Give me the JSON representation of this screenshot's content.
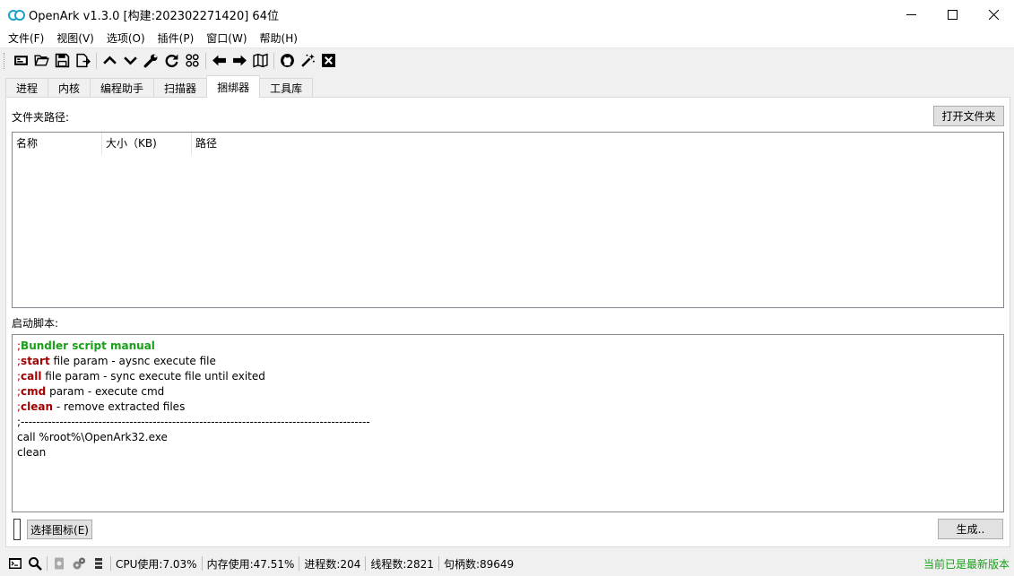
{
  "window": {
    "title": "OpenArk v1.3.0 [构建:202302271420]  64位",
    "accent": "#1aa3c8"
  },
  "menu": [
    "文件(F)",
    "视图(V)",
    "选项(O)",
    "插件(P)",
    "窗口(W)",
    "帮助(H)"
  ],
  "toolbar": {
    "icons": [
      "console-icon",
      "open-folder-icon",
      "save-icon",
      "export-icon",
      "chevron-up-icon",
      "chevron-down-icon",
      "wrench-icon",
      "refresh-icon",
      "grid-icon",
      "arrow-left-icon",
      "arrow-right-icon",
      "map-icon",
      "github-icon",
      "magic-wand-icon",
      "close-box-icon"
    ]
  },
  "tabs": [
    "进程",
    "内核",
    "编程助手",
    "扫描器",
    "捆绑器",
    "工具库"
  ],
  "active_tab": "捆绑器",
  "bundler": {
    "folder_label": "文件夹路径:",
    "open_folder_button": "打开文件夹",
    "columns": [
      "名称",
      "大小（KB)",
      "路径"
    ],
    "script_label": "启动脚本:",
    "script_lines": {
      "l1": "Bundler script manual",
      "l2_kw": "start",
      "l2_rest": " file param - aysnc execute file",
      "l3_kw": "call",
      "l3_rest": " file param - sync execute file until exited",
      "l4_kw": "cmd",
      "l4_rest": " param - execute cmd",
      "l5_kw": "clean",
      "l5_rest": " - remove extracted files",
      "l6": ";------------------------------------------------------------------------------------------",
      "l7": "call %root%\\OpenArk32.exe",
      "l8": "clean"
    },
    "semicolon": ";",
    "select_icon_button": "选择图标(E)",
    "generate_button": "生成.."
  },
  "status": {
    "cpu": "CPU使用:7.03%",
    "mem": "内存使用:47.51%",
    "proc": "进程数:204",
    "thread": "线程数:2821",
    "handle": "句柄数:89649",
    "update": "当前已是最新版本",
    "update_color": "#18a018"
  }
}
